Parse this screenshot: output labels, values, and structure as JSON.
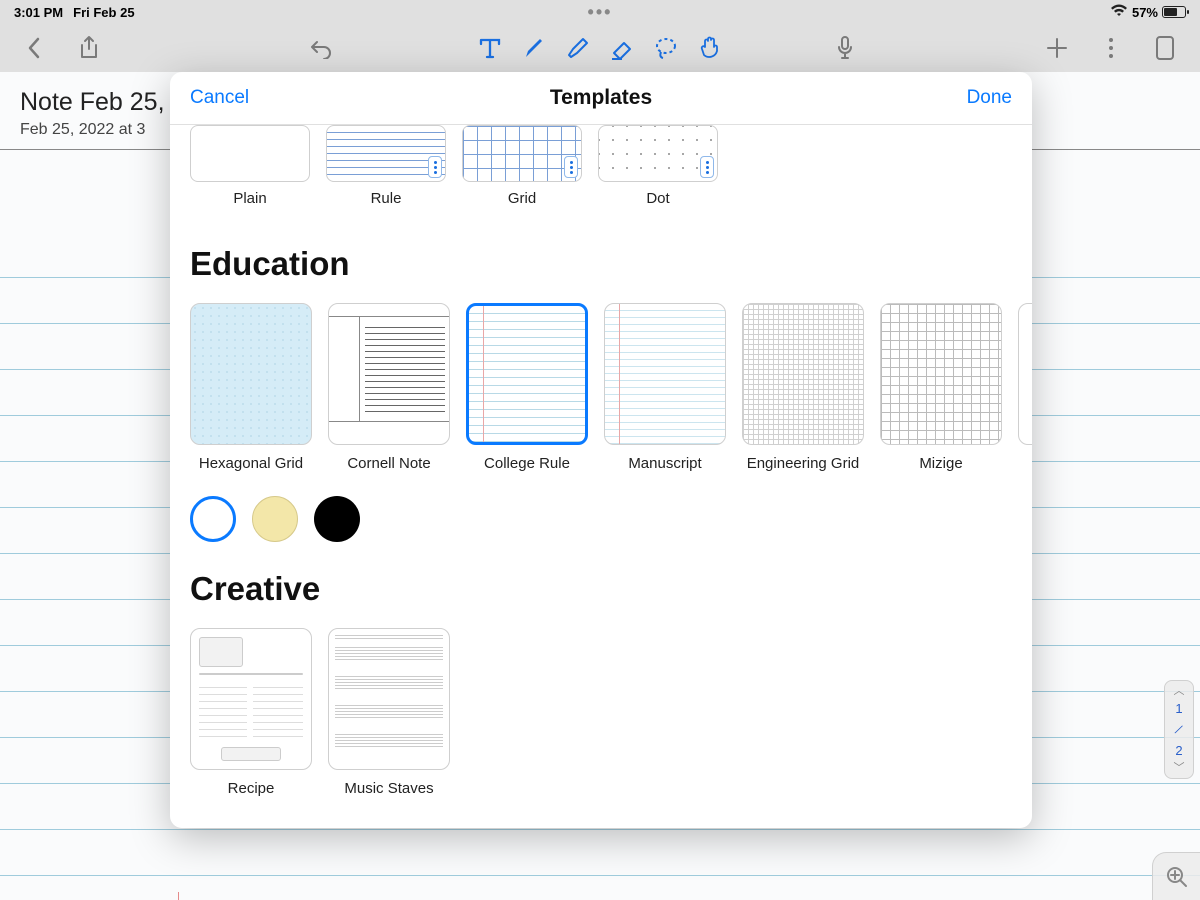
{
  "status": {
    "time": "3:01 PM",
    "date": "Fri Feb 25",
    "battery_pct": "57%"
  },
  "note": {
    "title": "Note Feb 25,",
    "subtitle": "Feb 25, 2022 at 3"
  },
  "modal": {
    "cancel": "Cancel",
    "title": "Templates",
    "done": "Done",
    "top_row": [
      {
        "label": "Plain"
      },
      {
        "label": "Rule"
      },
      {
        "label": "Grid"
      },
      {
        "label": "Dot"
      }
    ],
    "sections": {
      "education": {
        "title": "Education",
        "items": [
          {
            "label": "Hexagonal Grid"
          },
          {
            "label": "Cornell Note"
          },
          {
            "label": "College Rule",
            "selected": true
          },
          {
            "label": "Manuscript"
          },
          {
            "label": "Engineering Grid"
          },
          {
            "label": "Mizige"
          }
        ]
      },
      "creative": {
        "title": "Creative",
        "items": [
          {
            "label": "Recipe"
          },
          {
            "label": "Music Staves"
          }
        ]
      }
    },
    "colors": [
      {
        "bg": "#ffffff",
        "selected": true
      },
      {
        "bg": "#f3e7a9",
        "selected": false
      },
      {
        "bg": "#000000",
        "selected": false
      }
    ]
  },
  "pager": {
    "current": "1",
    "total": "2"
  }
}
